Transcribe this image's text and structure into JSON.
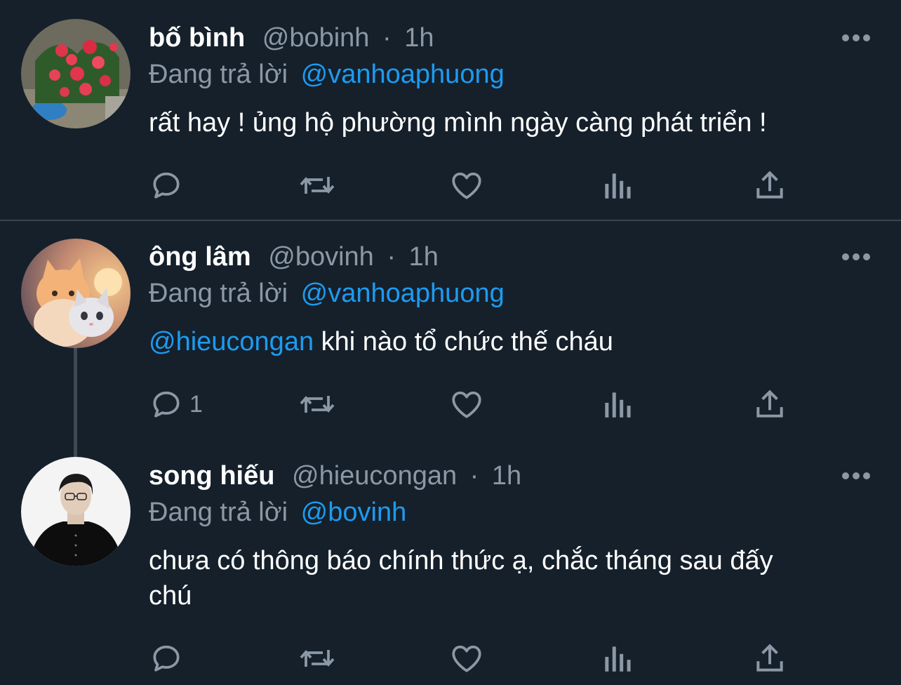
{
  "tweets": [
    {
      "display_name": "bố bình",
      "handle": "@bobinh",
      "separator": "·",
      "time": "1h",
      "reply_prefix": "Đang trả lời",
      "reply_to": "@vanhoaphuong",
      "body_mention": "",
      "body_text": "rất hay ! ủng hộ phường mình ngày càng phát triển !",
      "reply_count": "",
      "avatar_icon": "red-flowers-avatar"
    },
    {
      "display_name": "ông lâm",
      "handle": "@bovinh",
      "separator": "·",
      "time": "1h",
      "reply_prefix": "Đang trả lời",
      "reply_to": "@vanhoaphuong",
      "body_mention": "@hieucongan",
      "body_text": "khi nào tổ chức thế cháu",
      "reply_count": "1",
      "avatar_icon": "kittens-avatar"
    },
    {
      "display_name": "song hiếu",
      "handle": "@hieucongan",
      "separator": "·",
      "time": "1h",
      "reply_prefix": "Đang trả lời",
      "reply_to": "@bovinh",
      "body_mention": "",
      "body_text": "chưa có thông báo chính thức ạ, chắc tháng sau đấy chú",
      "reply_count": "",
      "avatar_icon": "person-photo-avatar"
    }
  ],
  "icons": {
    "reply": "reply-icon",
    "retweet": "retweet-icon",
    "like": "heart-icon",
    "views": "views-icon",
    "share": "share-icon",
    "more": "more-icon"
  },
  "colors": {
    "background": "#15202b",
    "text_primary": "#ffffff",
    "text_secondary": "#8b98a5",
    "link": "#1d9bf0",
    "divider": "#38444d"
  }
}
